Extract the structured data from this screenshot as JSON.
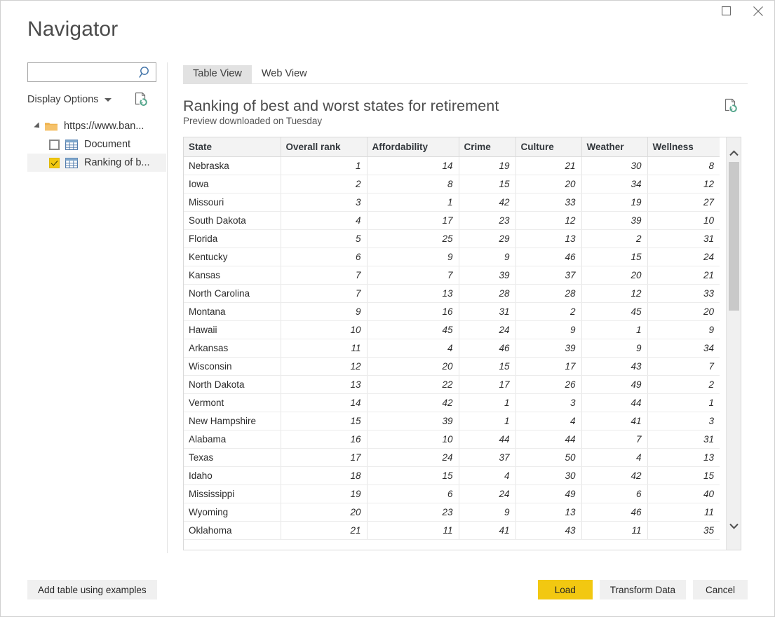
{
  "window": {
    "title": "Navigator",
    "controls": [
      {
        "name": "maximize",
        "label": "Maximize"
      },
      {
        "name": "close",
        "label": "Close"
      }
    ]
  },
  "sidebar": {
    "search": {
      "value": "",
      "placeholder": ""
    },
    "display_options_label": "Display Options",
    "refresh_icon_label": "Refresh",
    "tree": [
      {
        "label": "https://www.ban...",
        "level": 0,
        "icon": "folder-icon",
        "expanded": true,
        "checkbox": null,
        "selected": false
      },
      {
        "label": "Document",
        "level": 1,
        "icon": "table-icon",
        "checkbox": "unchecked",
        "selected": false
      },
      {
        "label": "Ranking of b...",
        "level": 1,
        "icon": "table-icon",
        "checkbox": "checked",
        "selected": true
      }
    ]
  },
  "main": {
    "tabs": [
      {
        "label": "Table View",
        "active": true
      },
      {
        "label": "Web View",
        "active": false
      }
    ],
    "preview": {
      "title": "Ranking of best and worst states for retirement",
      "subtitle": "Preview downloaded on Tuesday",
      "refresh_icon_label": "Refresh preview"
    }
  },
  "table": {
    "columns": [
      "State",
      "Overall rank",
      "Affordability",
      "Crime",
      "Culture",
      "Weather",
      "Wellness"
    ],
    "rows": [
      [
        "Nebraska",
        "1",
        "14",
        "19",
        "21",
        "30",
        "8"
      ],
      [
        "Iowa",
        "2",
        "8",
        "15",
        "20",
        "34",
        "12"
      ],
      [
        "Missouri",
        "3",
        "1",
        "42",
        "33",
        "19",
        "27"
      ],
      [
        "South Dakota",
        "4",
        "17",
        "23",
        "12",
        "39",
        "10"
      ],
      [
        "Florida",
        "5",
        "25",
        "29",
        "13",
        "2",
        "31"
      ],
      [
        "Kentucky",
        "6",
        "9",
        "9",
        "46",
        "15",
        "24"
      ],
      [
        "Kansas",
        "7",
        "7",
        "39",
        "37",
        "20",
        "21"
      ],
      [
        "North Carolina",
        "7",
        "13",
        "28",
        "28",
        "12",
        "33"
      ],
      [
        "Montana",
        "9",
        "16",
        "31",
        "2",
        "45",
        "20"
      ],
      [
        "Hawaii",
        "10",
        "45",
        "24",
        "9",
        "1",
        "9"
      ],
      [
        "Arkansas",
        "11",
        "4",
        "46",
        "39",
        "9",
        "34"
      ],
      [
        "Wisconsin",
        "12",
        "20",
        "15",
        "17",
        "43",
        "7"
      ],
      [
        "North Dakota",
        "13",
        "22",
        "17",
        "26",
        "49",
        "2"
      ],
      [
        "Vermont",
        "14",
        "42",
        "1",
        "3",
        "44",
        "1"
      ],
      [
        "New Hampshire",
        "15",
        "39",
        "1",
        "4",
        "41",
        "3"
      ],
      [
        "Alabama",
        "16",
        "10",
        "44",
        "44",
        "7",
        "31"
      ],
      [
        "Texas",
        "17",
        "24",
        "37",
        "50",
        "4",
        "13"
      ],
      [
        "Idaho",
        "18",
        "15",
        "4",
        "30",
        "42",
        "15"
      ],
      [
        "Mississippi",
        "19",
        "6",
        "24",
        "49",
        "6",
        "40"
      ],
      [
        "Wyoming",
        "20",
        "23",
        "9",
        "13",
        "46",
        "11"
      ],
      [
        "Oklahoma",
        "21",
        "11",
        "41",
        "43",
        "11",
        "35"
      ]
    ]
  },
  "footer": {
    "add_table_label": "Add table using examples",
    "load_label": "Load",
    "transform_label": "Transform Data",
    "cancel_label": "Cancel"
  },
  "colors": {
    "accent_yellow": "#f2c811",
    "tab_active_bg": "#e2e2e2",
    "header_bg": "#f3f3f3",
    "text_primary": "#2b2b2b",
    "title_gray": "#4c4c4c"
  }
}
